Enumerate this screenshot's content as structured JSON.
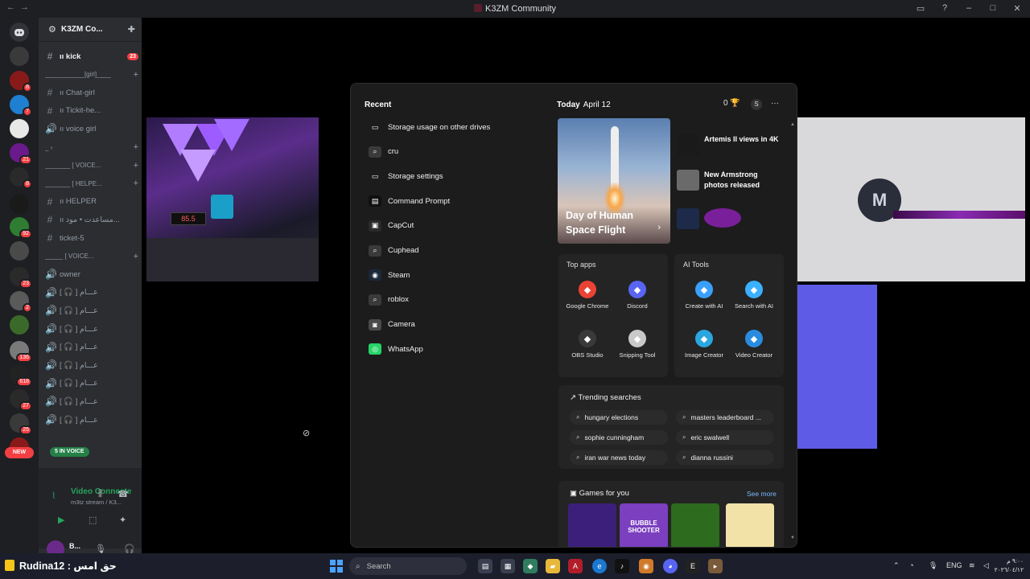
{
  "window": {
    "title": "K3ZM Community",
    "nav_back": "←",
    "nav_forward": "→"
  },
  "server_rail": {
    "badges": [
      "8",
      "7",
      "21",
      "8",
      "92",
      "23",
      "2",
      "136",
      "618",
      "27",
      "25",
      "79"
    ],
    "new_label": "NEW"
  },
  "channel_sidebar": {
    "server_name": "K3ZM Co...",
    "rows": [
      {
        "type": "channel",
        "label": "ıı kick",
        "count": "23",
        "active": true
      },
      {
        "type": "category",
        "label": "___________[girl]____"
      },
      {
        "type": "channel",
        "label": "ıı Chat-girl"
      },
      {
        "type": "channel",
        "label": "ıı Tickit-he..."
      },
      {
        "type": "voice",
        "label": "ıı voice girl"
      },
      {
        "type": "category",
        "label": "_ ›"
      },
      {
        "type": "category",
        "label": "_______ [ VOICE..."
      },
      {
        "type": "category",
        "label": "_______ [ HELPE..."
      },
      {
        "type": "channel",
        "label": "ıı HELPER"
      },
      {
        "type": "channel",
        "label": "ıı مساعدت • مود..."
      },
      {
        "type": "channel",
        "label": "ticket-5"
      },
      {
        "type": "category",
        "label": "_____ [ VOICE..."
      },
      {
        "type": "voice",
        "label": "owner"
      },
      {
        "type": "voice",
        "label": "[ 🎧 ] عـــام"
      },
      {
        "type": "voice",
        "label": "[ 🎧 ] عـــام"
      },
      {
        "type": "voice",
        "label": "[ 🎧 ] عـــام"
      },
      {
        "type": "voice",
        "label": "[ 🎧 ] عـــام"
      },
      {
        "type": "voice",
        "label": "[ 🎧 ] عـــام"
      },
      {
        "type": "voice",
        "label": "[ 🎧 ] عـــام"
      },
      {
        "type": "voice",
        "label": "[ 🎧 ] عـــام"
      },
      {
        "type": "voice",
        "label": "[ 🎧 ] عـــام"
      }
    ],
    "in_voice": "5 IN VOICE",
    "voice_status": "Video Connecte",
    "voice_sub": "m3tz stream / K3...",
    "user_name": "B..."
  },
  "start_menu": {
    "recent_heading": "Recent",
    "recent_items": [
      {
        "label": "Storage usage on other drives",
        "icon": "drive-icon"
      },
      {
        "label": "cru",
        "icon": "search-icon"
      },
      {
        "label": "Storage settings",
        "icon": "drive-icon"
      },
      {
        "label": "Command Prompt",
        "icon": "terminal-icon"
      },
      {
        "label": "CapCut",
        "icon": "capcut-icon"
      },
      {
        "label": "Cuphead",
        "icon": "search-icon"
      },
      {
        "label": "Steam",
        "icon": "steam-icon"
      },
      {
        "label": "roblox",
        "icon": "search-icon"
      },
      {
        "label": "Camera",
        "icon": "camera-icon"
      },
      {
        "label": "WhatsApp",
        "icon": "whatsapp-icon"
      }
    ],
    "today_label": "Today",
    "date": "April 12",
    "points": "0",
    "profile_initial": "S",
    "more": "···",
    "hero_title": "Day of Human Space Flight",
    "hero_arrow": "›",
    "news": [
      {
        "title": "Artemis II views in 4K"
      },
      {
        "title": "New Armstrong photos released"
      }
    ],
    "top_apps_heading": "Top apps",
    "top_apps": [
      {
        "label": "Google Chrome",
        "color": "#ea4335"
      },
      {
        "label": "Discord",
        "color": "#5865f2"
      },
      {
        "label": "OBS Studio",
        "color": "#3a3a3a"
      },
      {
        "label": "Snipping Tool",
        "color": "#c9c9c9"
      }
    ],
    "ai_tools_heading": "AI Tools",
    "ai_tools": [
      {
        "label": "Create with AI",
        "color": "#3aa0ff"
      },
      {
        "label": "Search with AI",
        "color": "#3ab0ff"
      },
      {
        "label": "Image Creator",
        "color": "#2aa6e0"
      },
      {
        "label": "Video Creator",
        "color": "#2a8ce0"
      }
    ],
    "trending_heading": "Trending searches",
    "trending": [
      "hungary elections",
      "masters leaderboard ...",
      "sophie cunningham",
      "eric swalwell",
      "iran war news today",
      "dianna russini"
    ],
    "games_heading": "Games for you",
    "see_more": "See more",
    "games": [
      {
        "name": "game-1",
        "color": "#3b1f7a"
      },
      {
        "name": "bubble-shooter",
        "label": "BUBBLE SHOOTER",
        "color": "#7b3fbf"
      },
      {
        "name": "cut-the-rope",
        "color": "#2d6b1e"
      },
      {
        "name": "cat-game",
        "color": "#f2e2a8"
      }
    ]
  },
  "taskbar": {
    "news_text": "Rudina12 : حق امس",
    "search_placeholder": "Search",
    "tray_lang": "ENG",
    "clock_time": "٩:٠٠ م",
    "clock_date": "٢٠٢٦/٠٤/١٢"
  }
}
